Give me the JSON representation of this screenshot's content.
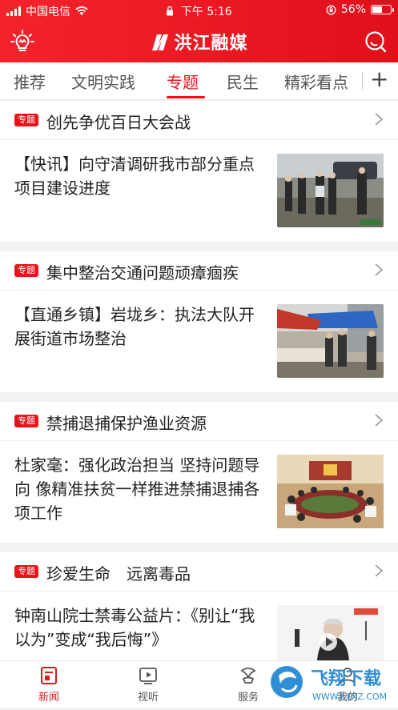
{
  "status": {
    "carrier": "中国电信",
    "time": "下午 5:16",
    "battery_percent": "56%",
    "battery_level": 0.56
  },
  "app": {
    "title": "洪江融媒"
  },
  "tabs": [
    {
      "label": "推荐"
    },
    {
      "label": "文明实践"
    },
    {
      "label": "专题"
    },
    {
      "label": "民生"
    },
    {
      "label": "精彩看点"
    }
  ],
  "active_tab": "专题",
  "badge_label": "专题",
  "sections": [
    {
      "heading": "创先争优百日大会战",
      "story": "【快讯】向守清调研我市部分重点项目建设进度"
    },
    {
      "heading": "集中整治交通问题顽瘴痼疾",
      "story": "【直通乡镇】岩垅乡：执法大队开展街道市场整治"
    },
    {
      "heading": "禁捕退捕保护渔业资源",
      "story": "杜家毫：强化政治担当 坚持问题导向 像精准扶贫一样推进禁捕退捕各项工作"
    },
    {
      "heading": "珍爱生命　远离毒品",
      "story": "钟南山院士禁毒公益片：《别让“我以为”变成“我后悔”》"
    }
  ],
  "bottom_nav": [
    {
      "label": "新闻",
      "icon": "news-icon"
    },
    {
      "label": "视听",
      "icon": "video-icon"
    },
    {
      "label": "服务",
      "icon": "service-icon"
    },
    {
      "label": "我的",
      "icon": "profile-icon"
    }
  ],
  "watermark": {
    "text": "飞翔下载",
    "url_text": "WWW.FXXZ.COM"
  },
  "colors": {
    "brand": "#e8141c",
    "text": "#222222",
    "background": "#f2f2f2"
  }
}
